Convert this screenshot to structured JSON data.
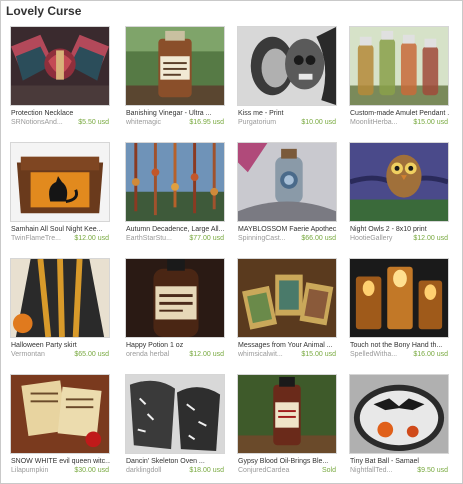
{
  "treasury": {
    "title": "Lovely Curse"
  },
  "items": [
    {
      "name": "Protection Necklace",
      "shop": "SRNotionsAnd...",
      "price": "$5.50 usd",
      "thumb": "winged-heart-necklace"
    },
    {
      "name": "Banishing Vinegar - Ultra ...",
      "shop": "whitemagic",
      "price": "$16.95 usd",
      "thumb": "banishing-vinegar-bottle"
    },
    {
      "name": "Kiss me - Print",
      "shop": "Purgatorium",
      "price": "$10.00 usd",
      "thumb": "skull-kiss-print"
    },
    {
      "name": "Custom-made Amulet Pendant ...",
      "shop": "MoonlitHerba...",
      "price": "$15.00 usd",
      "thumb": "amulet-vials"
    },
    {
      "name": "Samhain All Soul Night Kee...",
      "shop": "TwinFlameTre...",
      "price": "$12.00 usd",
      "thumb": "black-cat-box"
    },
    {
      "name": "Autumn Decadence, Large All...",
      "shop": "EarthStarStu...",
      "price": "$77.00 usd",
      "thumb": "autumn-bead-garland"
    },
    {
      "name": "MAYBLOSSOM Faerie Apothec...",
      "shop": "SpinningCast...",
      "price": "$66.00 usd",
      "thumb": "apothecary-bottle-pendant"
    },
    {
      "name": "Night Owls 2 - 8x10 print",
      "shop": "HootieGallery",
      "price": "$12.00 usd",
      "thumb": "night-owl-print"
    },
    {
      "name": "Halloween Party skirt",
      "shop": "Vermontan",
      "price": "$65.00 usd",
      "thumb": "halloween-skirt"
    },
    {
      "name": "Happy Potion 1 oz",
      "shop": "orenda herbal",
      "price": "$12.00 usd",
      "thumb": "happy-potion-bottle"
    },
    {
      "name": "Messages from Your Animal ...",
      "shop": "whimsicalwit...",
      "price": "$15.00 usd",
      "thumb": "animal-oracle-cards"
    },
    {
      "name": "Touch not the Bony Hand th...",
      "shop": "SpelledWitha...",
      "price": "$16.00 usd",
      "thumb": "candle-jars"
    },
    {
      "name": "SNOW WHITE evil queen witc...",
      "shop": "Lilapumpkin",
      "price": "$30.00 usd",
      "thumb": "evil-queen-scroll"
    },
    {
      "name": "Dancin' Skeleton Oven ...",
      "shop": "darklingdoll",
      "price": "$18.00 usd",
      "thumb": "skeleton-oven-mitts"
    },
    {
      "name": "Gypsy Blood Oil-Brings Ble...",
      "shop": "ConjuredCardea",
      "price": "Sold",
      "thumb": "gypsy-blood-oil"
    },
    {
      "name": "Tiny Bat Ball - Samael",
      "shop": "NightfallTed...",
      "price": "$9.50 usd",
      "thumb": "tiny-bat-ball"
    }
  ]
}
